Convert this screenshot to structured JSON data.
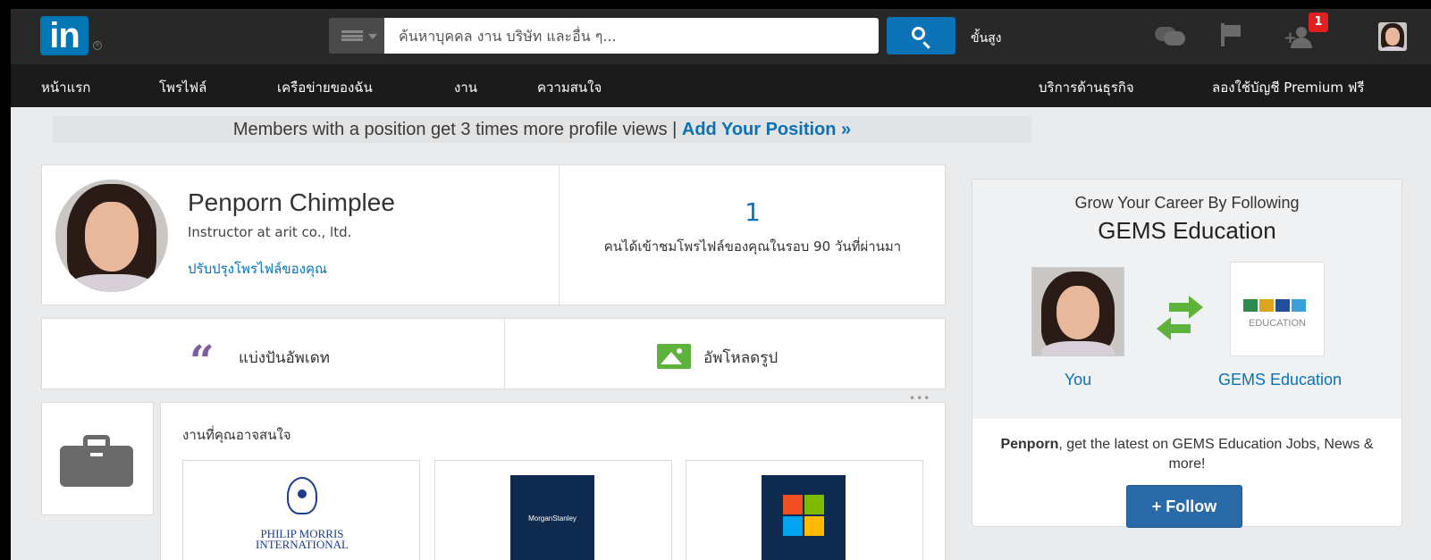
{
  "header": {
    "logo_text": "in",
    "logo_reg": "®",
    "search_placeholder": "ค้นหาบุคคล งาน บริษัท และอื่น ๆ...",
    "advanced_label": "ขั้นสูง",
    "notification_count": "1"
  },
  "nav": {
    "items": [
      "หน้าแรก",
      "โพรไฟล์",
      "เครือข่ายของฉัน",
      "งาน",
      "ความสนใจ"
    ],
    "business": "บริการด้านธุรกิจ",
    "premium": "ลองใช้บัญชี Premium ฟรี"
  },
  "banner": {
    "text": "Members with a position get 3 times more profile views |",
    "cta": "Add Your Position »"
  },
  "profile": {
    "name": "Penporn Chimplee",
    "headline": "Instructor at arit co., ltd.",
    "improve_link": "ปรับปรุงโพรไฟล์ของคุณ",
    "views_count": "1",
    "views_desc": "คนได้เข้าชมโพรไฟล์ของคุณในรอบ 90 วันที่ผ่านมา"
  },
  "share": {
    "update_label": "แบ่งปันอัพเดท",
    "upload_label": "อัพโหลดรูป",
    "more": "•••"
  },
  "jobs": {
    "title": "งานที่คุณอาจสนใจ",
    "companies": [
      {
        "logo_text": "PHILIP MORRIS INTERNATIONAL"
      },
      {
        "logo_text": "MorganStanley"
      },
      {
        "logo_text": ""
      }
    ]
  },
  "right": {
    "grow_text": "Grow Your Career By Following",
    "company": "GEMS Education",
    "gems_logo_sub": "EDUCATION",
    "you_label": "You",
    "company_label": "GEMS Education",
    "msg_name": "Penporn",
    "msg_rest": ", get the latest on GEMS Education Jobs, News & more!",
    "follow_label": "+ Follow"
  },
  "colors": {
    "brand": "#0077b5",
    "link": "#0b72b5",
    "green": "#5eb33c",
    "purple": "#7d5ca2",
    "badge": "#e02020"
  }
}
